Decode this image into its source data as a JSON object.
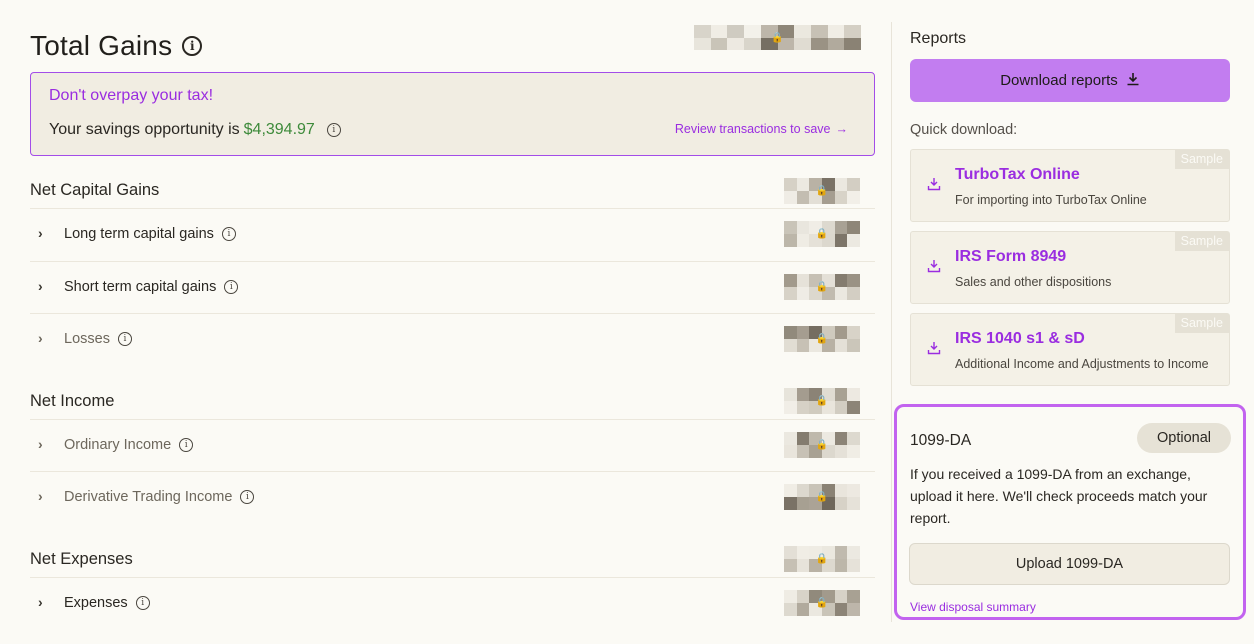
{
  "header": {
    "title": "Total Gains",
    "info_icon": "info-icon"
  },
  "savings": {
    "heading": "Don't overpay your tax!",
    "text": "Your savings opportunity is ",
    "amount": "$4,394.97",
    "link": "Review transactions to save",
    "colors": {
      "accent": "#9a2de0",
      "amount": "#3d8a3a"
    }
  },
  "sections": {
    "gains": {
      "title": "Net Capital Gains",
      "rows": [
        {
          "label": "Long term capital gains"
        },
        {
          "label": "Short term capital gains"
        },
        {
          "label": "Losses"
        }
      ]
    },
    "income": {
      "title": "Net Income",
      "rows": [
        {
          "label": "Ordinary Income"
        },
        {
          "label": "Derivative Trading Income"
        }
      ]
    },
    "expenses": {
      "title": "Net Expenses",
      "rows": [
        {
          "label": "Expenses"
        }
      ]
    }
  },
  "reports": {
    "title": "Reports",
    "download_button": "Download reports",
    "quick_label": "Quick download:",
    "cards": [
      {
        "title": "TurboTax Online",
        "subtitle": "For importing into TurboTax Online",
        "badge": "Sample"
      },
      {
        "title": "IRS Form 8949",
        "subtitle": "Sales and other dispositions",
        "badge": "Sample"
      },
      {
        "title": "IRS 1040 s1 & sD",
        "subtitle": "Additional Income and Adjustments to Income",
        "badge": "Sample"
      }
    ]
  },
  "da": {
    "title": "1099-DA",
    "badge": "Optional",
    "body": "If you received a 1099-DA from an exchange, upload it here. We'll check proceeds match your report.",
    "upload_button": "Upload 1099-DA",
    "link": "View disposal summary"
  }
}
